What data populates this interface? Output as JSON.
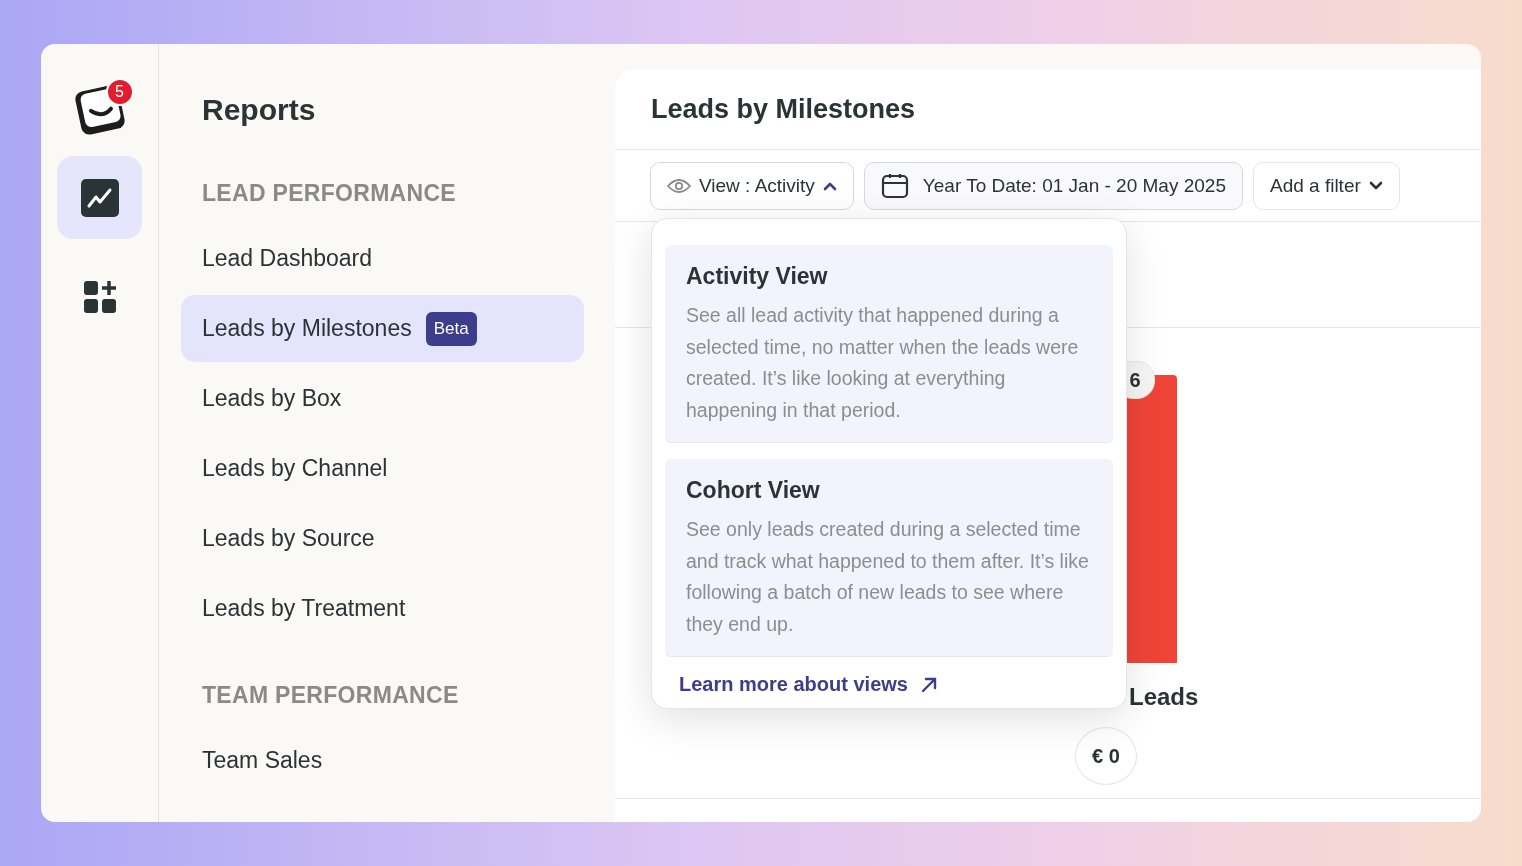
{
  "rail": {
    "notification_count": "5",
    "items": [
      {
        "kind": "reports",
        "selected": true
      },
      {
        "kind": "apps",
        "selected": false
      }
    ]
  },
  "nav": {
    "title": "Reports",
    "sections": [
      {
        "heading": "LEAD PERFORMANCE",
        "items": [
          {
            "label": "Lead Dashboard",
            "selected": false
          },
          {
            "label": "Leads by Milestones",
            "selected": true,
            "badge": "Beta"
          },
          {
            "label": "Leads by Box",
            "selected": false
          },
          {
            "label": "Leads by Channel",
            "selected": false
          },
          {
            "label": "Leads by Source",
            "selected": false
          },
          {
            "label": "Leads by Treatment",
            "selected": false
          }
        ]
      },
      {
        "heading": "TEAM PERFORMANCE",
        "items": [
          {
            "label": "Team Sales",
            "selected": false
          }
        ]
      }
    ]
  },
  "main": {
    "title": "Leads by Milestones",
    "filters": {
      "view": {
        "label": "View : Activity",
        "expanded": true
      },
      "date": "Year To Date: 01 Jan - 20 May 2025",
      "add_filter": "Add a filter"
    },
    "view_menu": {
      "options": [
        {
          "title": "Activity View",
          "description": "See all lead activity that happened during a selected time, no matter when the leads were created. It’s like looking at everything happening in that period."
        },
        {
          "title": "Cohort View",
          "description": "See only leads created during a selected time and track what happened to them after. It’s like following a batch of new leads to see where they end up."
        }
      ],
      "link": "Learn more about views"
    },
    "chart": {
      "count": "6",
      "label": "Leads",
      "amount": "€ 0"
    }
  }
}
